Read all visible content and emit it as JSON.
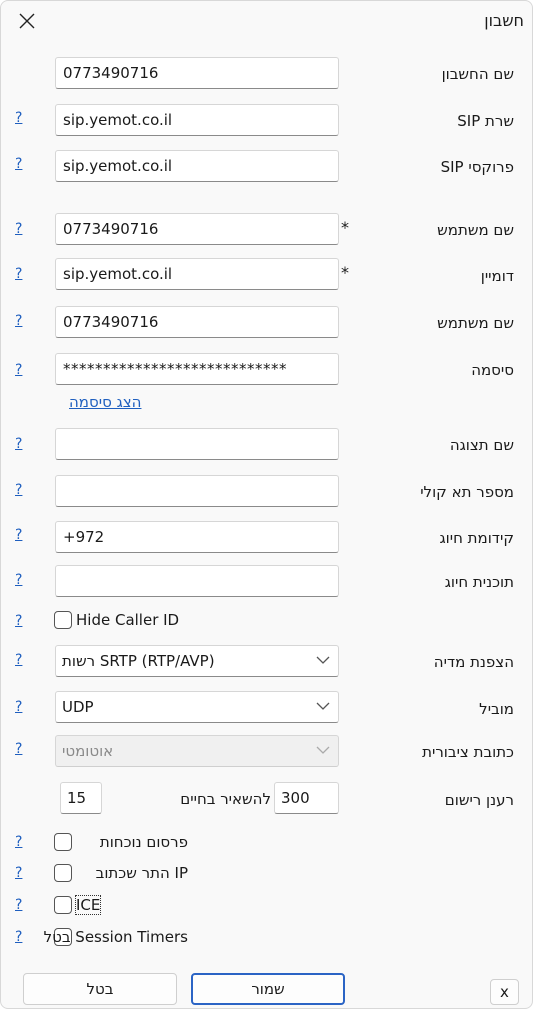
{
  "window": {
    "title": "חשבון"
  },
  "fields": {
    "account_name": {
      "label": "שם החשבון",
      "value": "0773490716"
    },
    "sip_server": {
      "label": "שרת SIP",
      "value": "sip.yemot.co.il"
    },
    "sip_proxy": {
      "label": "פרוקסי SIP",
      "value": "sip.yemot.co.il"
    },
    "username": {
      "label": "שם משתמש",
      "value": "0773490716"
    },
    "domain": {
      "label": "דומיין",
      "value": "sip.yemot.co.il"
    },
    "login": {
      "label": "שם משתמש",
      "value": "0773490716"
    },
    "password": {
      "label": "סיסמה",
      "value": "****************************",
      "show_link": "הצג סיסמה"
    },
    "display_name": {
      "label": "שם תצוגה",
      "value": ""
    },
    "voicemail": {
      "label": "מספר תא קולי",
      "value": ""
    },
    "dial_prefix": {
      "label": "קידומת חיוג",
      "value": "+972"
    },
    "dial_plan": {
      "label": "תוכנית חיוג",
      "value": ""
    }
  },
  "required_marker": "*",
  "help_link": "?",
  "hide_caller_id": {
    "label": "Hide Caller ID",
    "checked": false
  },
  "selects": {
    "media_encryption": {
      "label": "הצפנת מדיה",
      "value": "רשות SRTP (RTP/AVP)"
    },
    "transport": {
      "label": "מוביל",
      "value": "UDP"
    },
    "public_address": {
      "label": "כתובת ציבורית",
      "value": "אוטומטי",
      "disabled": true
    }
  },
  "registration": {
    "label": "רענן רישום",
    "value": "300",
    "keepalive_label": "להשאיר בחיים",
    "keepalive_value": "15"
  },
  "checkboxes": {
    "publish_presence": {
      "label": "פרסום נוכחות",
      "checked": false
    },
    "allow_ip_rewrite": {
      "label": "IP התר שכתוב",
      "checked": false
    },
    "ice": {
      "label": "ICE",
      "checked": false
    },
    "session_timers": {
      "label": "Session Timers בטל",
      "checked": false
    }
  },
  "buttons": {
    "x": "x",
    "save": "שמור",
    "cancel": "בטל"
  },
  "icons": {
    "close": "close-icon",
    "dropdown": "chevron-down-icon"
  }
}
